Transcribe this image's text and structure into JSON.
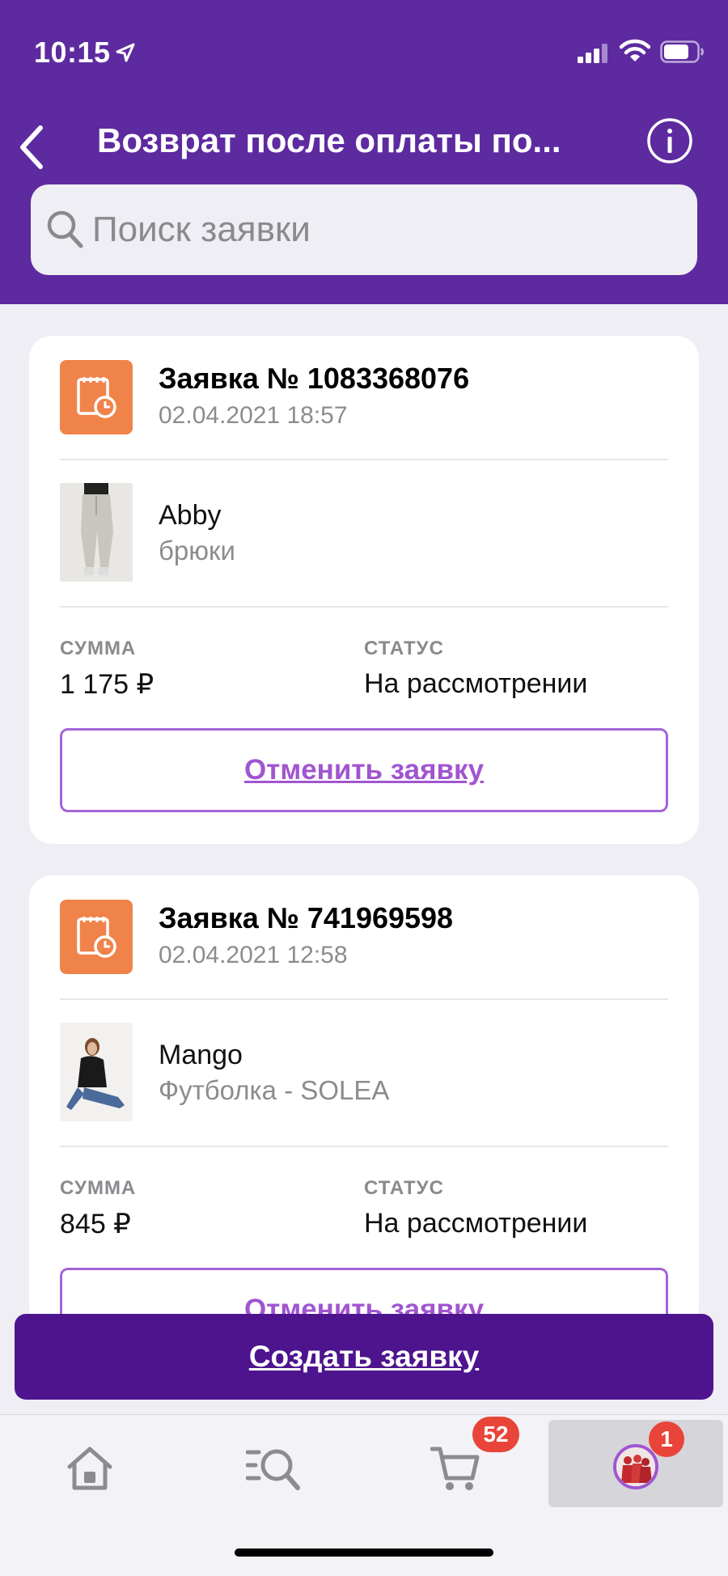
{
  "status_bar": {
    "time": "10:15"
  },
  "header": {
    "title": "Возврат после оплаты по..."
  },
  "search": {
    "placeholder": "Поиск заявки"
  },
  "requests": [
    {
      "title": "Заявка № 1083368076",
      "date": "02.04.2021 18:57",
      "brand": "Abby",
      "product": "брюки",
      "sum_label": "СУММА",
      "sum": "1 175 ₽",
      "status_label": "СТАТУС",
      "status": "На рассмотрении",
      "cancel_label": "Отменить заявку"
    },
    {
      "title": "Заявка № 741969598",
      "date": "02.04.2021 12:58",
      "brand": "Mango",
      "product": "Футболка - SOLEA",
      "sum_label": "СУММА",
      "sum": "845 ₽",
      "status_label": "СТАТУС",
      "status": "На рассмотрении",
      "cancel_label": "Отменить заявку"
    }
  ],
  "create_button": {
    "label": "Создать заявку"
  },
  "tab_bar": {
    "cart_badge": "52",
    "profile_badge": "1"
  },
  "colors": {
    "header": "#5e2aa0",
    "primary_button": "#4e148e",
    "accent": "#a055d0",
    "request_icon": "#f0834a",
    "badge": "#e8443a"
  }
}
